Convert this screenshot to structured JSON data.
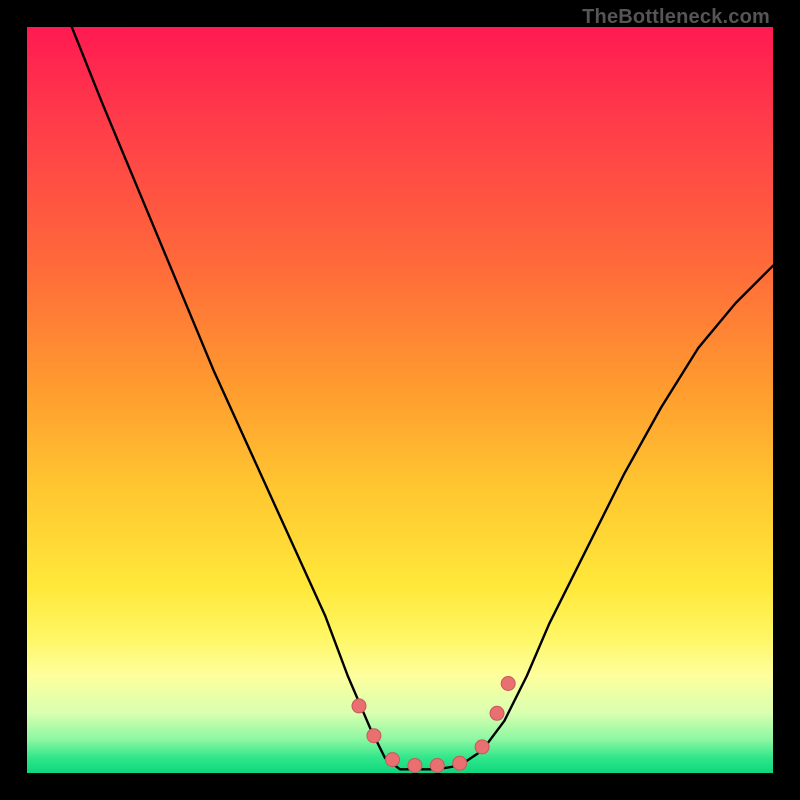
{
  "attribution": "TheBottleneck.com",
  "colors": {
    "frame": "#000000",
    "curve": "#000000",
    "marker_fill": "#e96f70",
    "marker_stroke": "#c55a5b",
    "gradient_top": "#ff1a52",
    "gradient_bottom": "#0fd77e"
  },
  "chart_data": {
    "type": "line",
    "title": "",
    "xlabel": "",
    "ylabel": "",
    "xlim": [
      0,
      100
    ],
    "ylim": [
      0,
      100
    ],
    "note": "Axes are unlabeled in the source image; values below are estimated from pixel positions on a 0–100 normalized scale (origin bottom-left). The curve is a V-shaped profile with a flat floor near y≈0. Markers cluster around the valley walls and floor.",
    "series": [
      {
        "name": "bottleneck-curve",
        "x": [
          6,
          10,
          15,
          20,
          25,
          30,
          35,
          40,
          43,
          46,
          48,
          50,
          52,
          55,
          58,
          61,
          64,
          67,
          70,
          75,
          80,
          85,
          90,
          95,
          100
        ],
        "y": [
          100,
          90,
          78,
          66,
          54,
          43,
          32,
          21,
          13,
          6,
          2,
          0.5,
          0.5,
          0.5,
          1,
          3,
          7,
          13,
          20,
          30,
          40,
          49,
          57,
          63,
          68
        ]
      }
    ],
    "markers": {
      "name": "highlighted-points",
      "x": [
        44.5,
        46.5,
        49,
        52,
        55,
        58,
        61,
        63,
        64.5
      ],
      "y": [
        9,
        5,
        1.8,
        1,
        1,
        1.3,
        3.5,
        8,
        12
      ]
    }
  }
}
